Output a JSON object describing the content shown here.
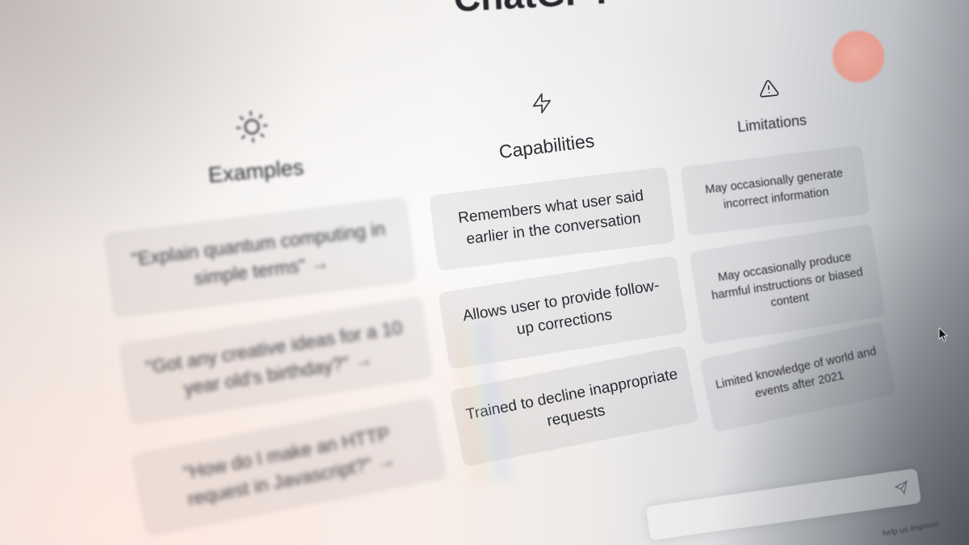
{
  "app": {
    "title": "ChatGPT"
  },
  "columns": [
    {
      "heading": "Examples",
      "icon": "sun-icon",
      "items": [
        {
          "lines": [
            "\"Explain quantum computing in",
            "simple terms\" →"
          ]
        },
        {
          "lines": [
            "\"Got any creative ideas for a 10",
            "year old's birthday?\" →"
          ]
        },
        {
          "lines": [
            "\"How do I make an HTTP",
            "request in Javascript?\" →"
          ]
        }
      ]
    },
    {
      "heading": "Capabilities",
      "icon": "lightning-icon",
      "items": [
        {
          "lines": [
            "Remembers what user said",
            "earlier in the conversation"
          ]
        },
        {
          "lines": [
            "Allows user to provide follow-",
            "up corrections"
          ]
        },
        {
          "lines": [
            "Trained to decline inappropriate",
            "requests"
          ]
        }
      ]
    },
    {
      "heading": "Limitations",
      "icon": "warning-icon",
      "items": [
        {
          "lines": [
            "May occasionally generate",
            "incorrect information"
          ]
        },
        {
          "lines": [
            "May occasionally produce",
            "harmful instructions or biased",
            "content"
          ]
        },
        {
          "lines": [
            "Limited knowledge of world and",
            "events after 2021"
          ]
        }
      ]
    }
  ],
  "composer": {
    "send_icon": "send-icon"
  },
  "footer": {
    "text": "help us improve"
  },
  "colors": {
    "text": "#2c2d33",
    "card_bg": "#3c3c4613",
    "bokeh": "#e7998c"
  }
}
